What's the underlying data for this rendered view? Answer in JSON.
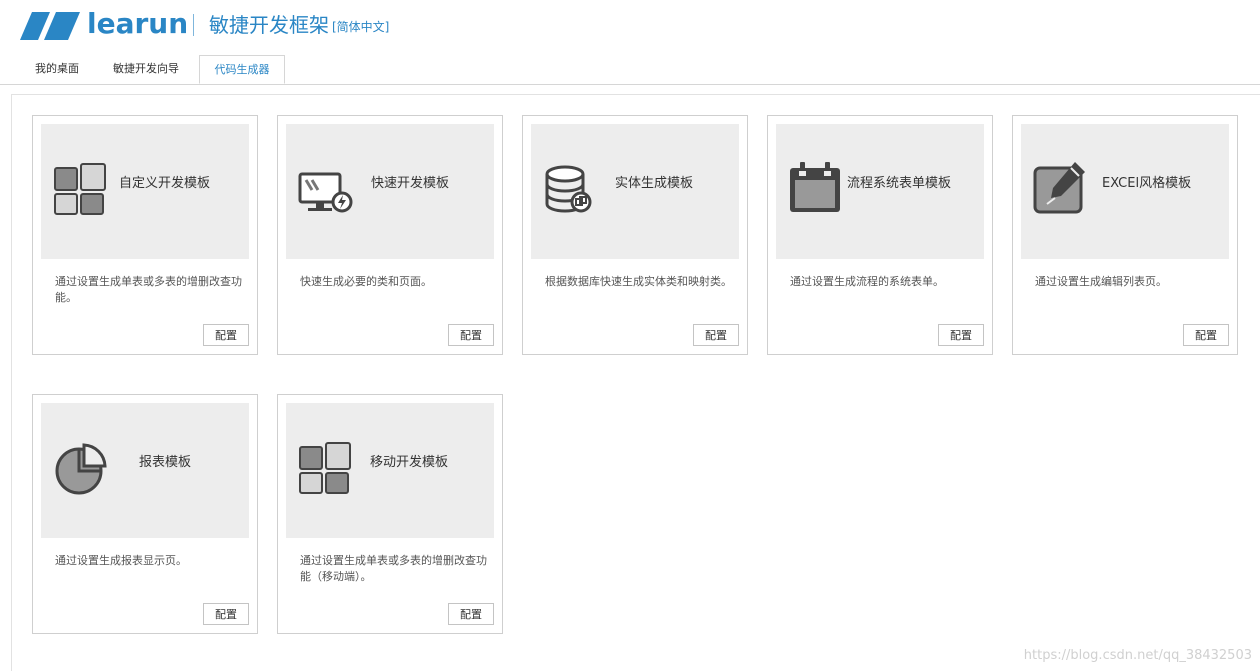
{
  "header": {
    "logo_text": "learun",
    "brand_title": "敏捷开发框架",
    "language": "[简体中文]",
    "brand_color": "#2a86c5"
  },
  "tabs": [
    {
      "label": "我的桌面",
      "active": false
    },
    {
      "label": "敏捷开发向导",
      "active": false
    },
    {
      "label": "代码生成器",
      "active": true
    }
  ],
  "cards": [
    {
      "title": "自定义开发模板",
      "icon": "tiles-icon",
      "description": "通过设置生成单表或多表的增删改查功能。",
      "button": "配置"
    },
    {
      "title": "快速开发模板",
      "icon": "monitor-icon",
      "description": "快速生成必要的类和页面。",
      "button": "配置"
    },
    {
      "title": "实体生成模板",
      "icon": "database-icon",
      "description": "根据数据库快速生成实体类和映射类。",
      "button": "配置"
    },
    {
      "title": "流程系统表单模板",
      "icon": "calendar-icon",
      "description": "通过设置生成流程的系统表单。",
      "button": "配置"
    },
    {
      "title": "EXCEl风格模板",
      "icon": "edit-icon",
      "description": "通过设置生成编辑列表页。",
      "button": "配置"
    },
    {
      "title": "报表模板",
      "icon": "pie-chart-icon",
      "description": "通过设置生成报表显示页。",
      "button": "配置"
    },
    {
      "title": "移动开发模板",
      "icon": "tiles-icon",
      "description": "通过设置生成单表或多表的增删改查功能（移动端）。",
      "button": "配置"
    }
  ],
  "watermark": "https://blog.csdn.net/qq_38432503"
}
